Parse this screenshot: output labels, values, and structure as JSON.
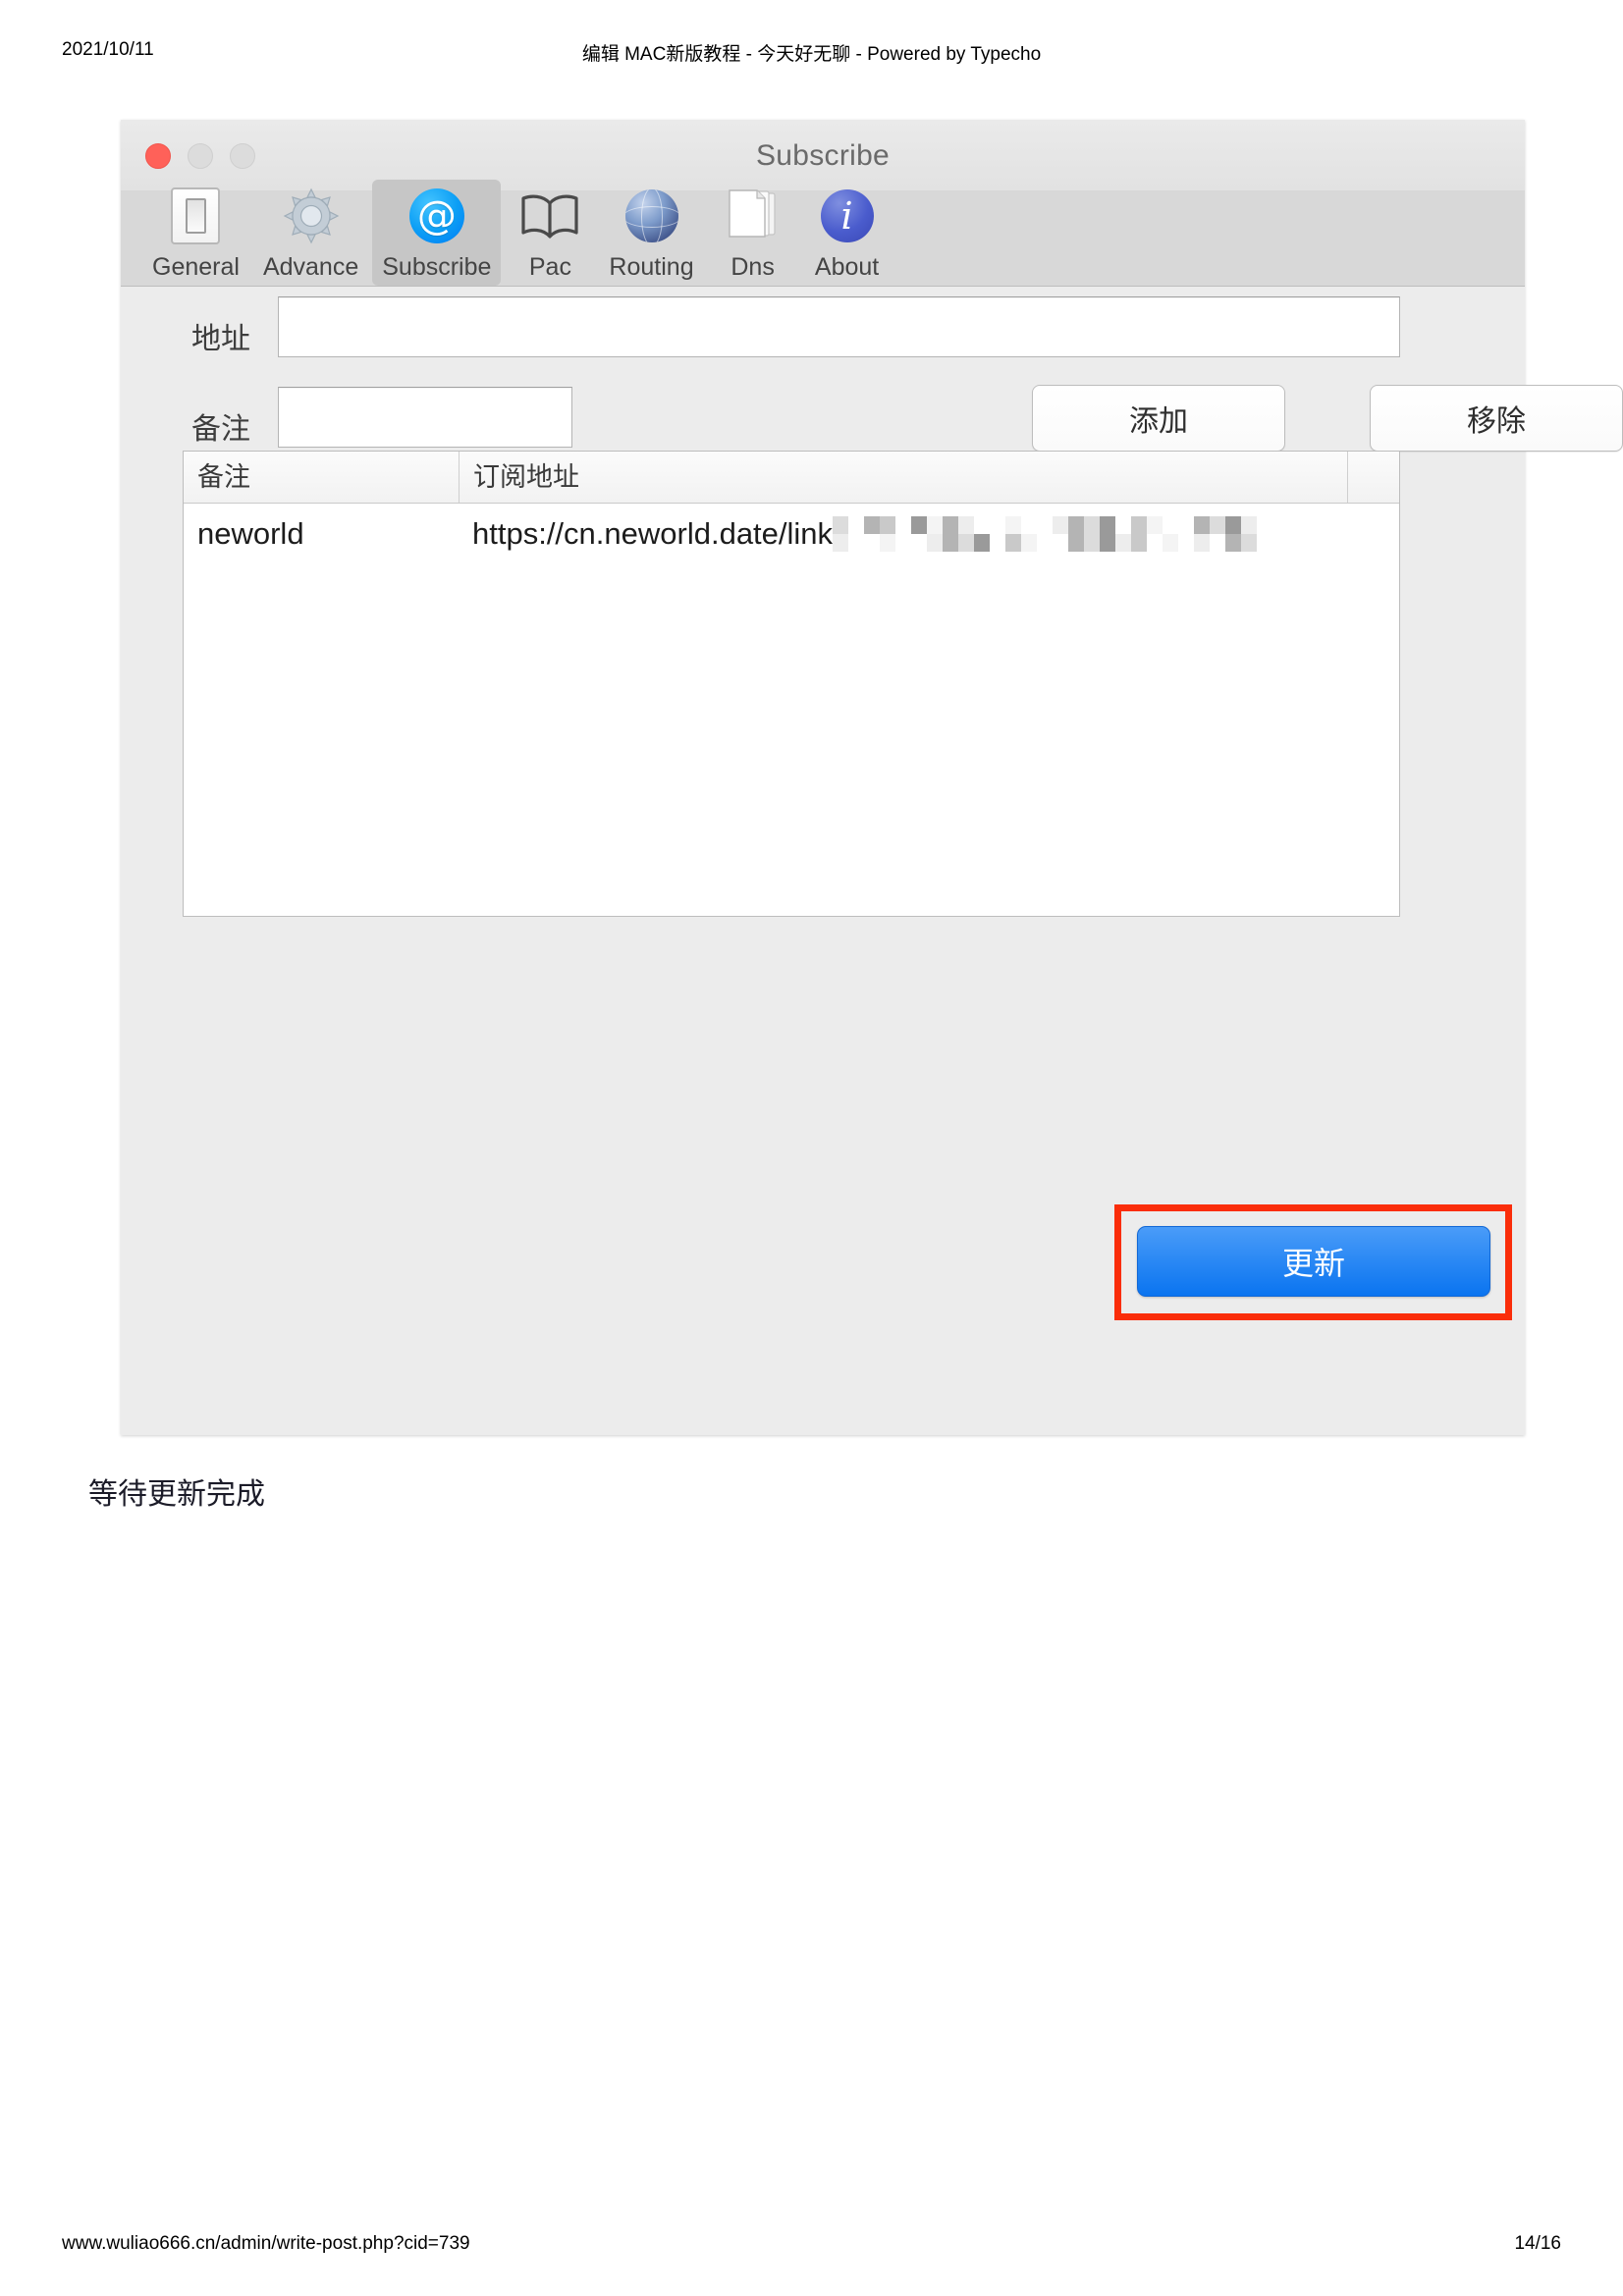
{
  "page": {
    "date": "2021/10/11",
    "doc_title": "编辑 MAC新版教程 - 今天好无聊 - Powered by Typecho",
    "footer_url": "www.wuliao666.cn/admin/write-post.php?cid=739",
    "footer_page": "14/16"
  },
  "window": {
    "title": "Subscribe",
    "traffic_lights": {
      "close": "close-button",
      "minimize": "minimize-button",
      "maximize": "maximize-button"
    }
  },
  "toolbar": {
    "items": [
      {
        "label": "General",
        "icon": "light-switch-icon",
        "selected": false
      },
      {
        "label": "Advance",
        "icon": "gear-icon",
        "selected": false
      },
      {
        "label": "Subscribe",
        "icon": "at-sign-icon",
        "selected": true
      },
      {
        "label": "Pac",
        "icon": "open-book-icon",
        "selected": false
      },
      {
        "label": "Routing",
        "icon": "globe-icon",
        "selected": false
      },
      {
        "label": "Dns",
        "icon": "documents-icon",
        "selected": false
      },
      {
        "label": "About",
        "icon": "info-circle-icon",
        "selected": false
      }
    ]
  },
  "form": {
    "address_label": "地址",
    "address_value": "",
    "remark_label": "备注",
    "remark_value": "",
    "add_button": "添加",
    "remove_button": "移除"
  },
  "table": {
    "columns": [
      "备注",
      "订阅地址",
      ""
    ],
    "rows": [
      {
        "remark": "neworld",
        "url_visible": "https://cn.neworld.date/link",
        "url_redacted": true
      }
    ]
  },
  "actions": {
    "update_button": "更新",
    "highlight_color": "#fa2d0a",
    "update_button_color": "#0a74f0"
  },
  "caption": "等待更新完成"
}
